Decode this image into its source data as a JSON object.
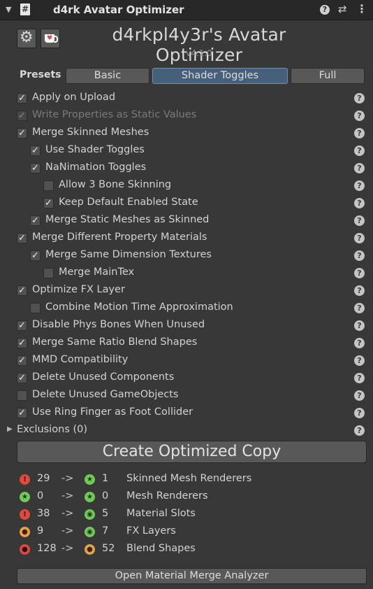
{
  "window": {
    "title": "d4rk Avatar Optimizer",
    "script_icon": "#"
  },
  "header": {
    "title": "d4rkpl4y3r's Avatar Optimizer",
    "version": "v4.1.0"
  },
  "presets": {
    "label": "Presets",
    "buttons": [
      {
        "label": "Basic",
        "active": false
      },
      {
        "label": "Shader Toggles",
        "active": true
      },
      {
        "label": "Full",
        "active": false
      }
    ]
  },
  "options": [
    {
      "label": "Apply on Upload",
      "checked": true,
      "indent": 0,
      "enabled": true
    },
    {
      "label": "Write Properties as Static Values",
      "checked": true,
      "indent": 0,
      "enabled": false
    },
    {
      "label": "Merge Skinned Meshes",
      "checked": true,
      "indent": 0,
      "enabled": true
    },
    {
      "label": "Use Shader Toggles",
      "checked": true,
      "indent": 1,
      "enabled": true
    },
    {
      "label": "NaNimation Toggles",
      "checked": true,
      "indent": 1,
      "enabled": true
    },
    {
      "label": "Allow 3 Bone Skinning",
      "checked": false,
      "indent": 2,
      "enabled": true
    },
    {
      "label": "Keep Default Enabled State",
      "checked": true,
      "indent": 2,
      "enabled": true
    },
    {
      "label": "Merge Static Meshes as Skinned",
      "checked": true,
      "indent": 1,
      "enabled": true
    },
    {
      "label": "Merge Different Property Materials",
      "checked": true,
      "indent": 0,
      "enabled": true
    },
    {
      "label": "Merge Same Dimension Textures",
      "checked": true,
      "indent": 1,
      "enabled": true
    },
    {
      "label": "Merge MainTex",
      "checked": false,
      "indent": 2,
      "enabled": true
    },
    {
      "label": "Optimize FX Layer",
      "checked": true,
      "indent": 0,
      "enabled": true
    },
    {
      "label": "Combine Motion Time Approximation",
      "checked": false,
      "indent": 1,
      "enabled": true
    },
    {
      "label": "Disable Phys Bones When Unused",
      "checked": true,
      "indent": 0,
      "enabled": true
    },
    {
      "label": "Merge Same Ratio Blend Shapes",
      "checked": true,
      "indent": 0,
      "enabled": true
    },
    {
      "label": "MMD Compatibility",
      "checked": true,
      "indent": 0,
      "enabled": true
    },
    {
      "label": "Delete Unused Components",
      "checked": true,
      "indent": 0,
      "enabled": true
    },
    {
      "label": "Delete Unused GameObjects",
      "checked": false,
      "indent": 0,
      "enabled": true
    },
    {
      "label": "Use Ring Finger as Foot Collider",
      "checked": true,
      "indent": 0,
      "enabled": true
    }
  ],
  "exclusions": {
    "label": "Exclusions (0)"
  },
  "help_glyph": "?",
  "create_button": "Create Optimized Copy",
  "stats": [
    {
      "before": "29",
      "after": "1",
      "name": "Skinned Mesh Renderers",
      "before_icon": "red-exclamation",
      "after_icon": "green-star"
    },
    {
      "before": "0",
      "after": "0",
      "name": "Mesh Renderers",
      "before_icon": "green-star",
      "after_icon": "green-star"
    },
    {
      "before": "38",
      "after": "5",
      "name": "Material Slots",
      "before_icon": "red-exclamation",
      "after_icon": "green-dot"
    },
    {
      "before": "9",
      "after": "7",
      "name": "FX Layers",
      "before_icon": "orange-dot",
      "after_icon": "green-dot"
    },
    {
      "before": "128",
      "after": "52",
      "name": "Blend Shapes",
      "before_icon": "red-dot",
      "after_icon": "orange-dot"
    }
  ],
  "stat_arrow": "->",
  "analyzer_button": "Open Material Merge Analyzer",
  "colors": {
    "background": "#383838",
    "active_preset": "#46607c",
    "red": "#e0493d",
    "green": "#72c95a",
    "orange": "#e6a445"
  }
}
